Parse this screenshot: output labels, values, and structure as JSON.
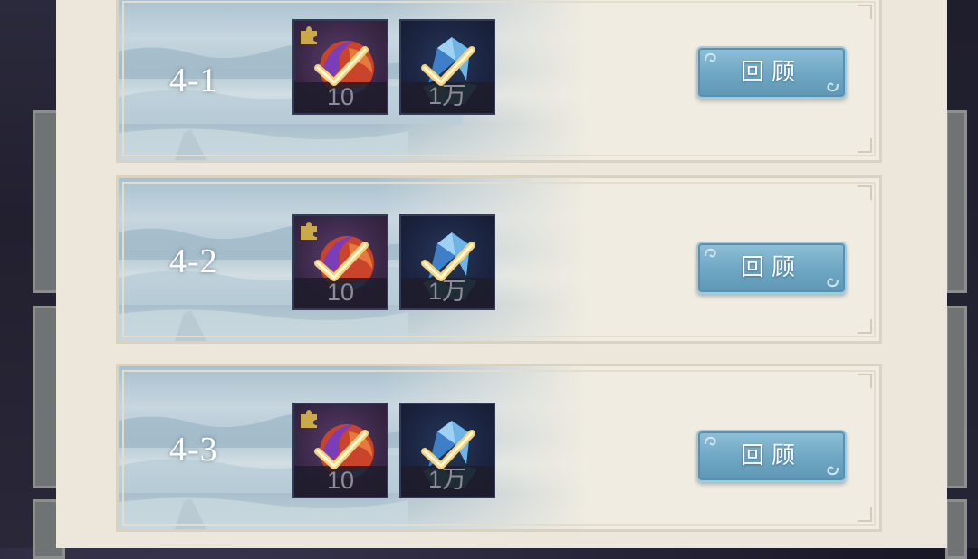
{
  "stages": [
    {
      "label": "4-1",
      "rewards": [
        {
          "icon": "fire-orb-icon",
          "count": "10",
          "claimed": true,
          "has_puzzle_badge": true
        },
        {
          "icon": "blue-crystal-icon",
          "count": "1万",
          "claimed": true,
          "has_puzzle_badge": false
        }
      ],
      "button_label": "回顾"
    },
    {
      "label": "4-2",
      "rewards": [
        {
          "icon": "fire-orb-icon",
          "count": "10",
          "claimed": true,
          "has_puzzle_badge": true
        },
        {
          "icon": "blue-crystal-icon",
          "count": "1万",
          "claimed": true,
          "has_puzzle_badge": false
        }
      ],
      "button_label": "回顾"
    },
    {
      "label": "4-3",
      "rewards": [
        {
          "icon": "fire-orb-icon",
          "count": "10",
          "claimed": true,
          "has_puzzle_badge": true
        },
        {
          "icon": "blue-crystal-icon",
          "count": "1万",
          "claimed": true,
          "has_puzzle_badge": false
        }
      ],
      "button_label": "回顾"
    }
  ],
  "colors": {
    "panel_bg": "#ece7da",
    "button_blue": "#6ea6c3",
    "check_gold": "#f2d27a",
    "count_gray": "#8f8c96"
  }
}
